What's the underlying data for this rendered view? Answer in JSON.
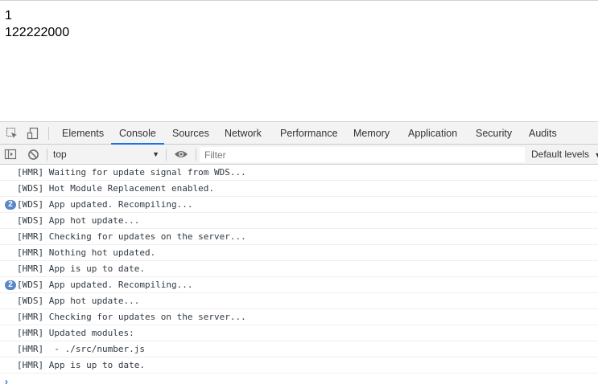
{
  "page": {
    "lines": [
      "1",
      "122222000"
    ]
  },
  "devtools": {
    "tabs": [
      {
        "label": "Elements",
        "active": false
      },
      {
        "label": "Console",
        "active": true
      },
      {
        "label": "Sources",
        "active": false
      },
      {
        "label": "Network",
        "active": false
      },
      {
        "label": "Performance",
        "active": false
      },
      {
        "label": "Memory",
        "active": false
      },
      {
        "label": "Application",
        "active": false
      },
      {
        "label": "Security",
        "active": false
      },
      {
        "label": "Audits",
        "active": false
      }
    ],
    "toolbar": {
      "context": "top",
      "filter_placeholder": "Filter",
      "levels_label": "Default levels"
    },
    "accent_color": "#1a73e8",
    "badge_color": "#5b86c9"
  },
  "console": {
    "rows": [
      {
        "text": "[HMR] Waiting for update signal from WDS...",
        "count": null
      },
      {
        "text": "[WDS] Hot Module Replacement enabled.",
        "count": null
      },
      {
        "text": "[WDS] App updated. Recompiling...",
        "count": "2"
      },
      {
        "text": "[WDS] App hot update...",
        "count": null
      },
      {
        "text": "[HMR] Checking for updates on the server...",
        "count": null
      },
      {
        "text": "[HMR] Nothing hot updated.",
        "count": null
      },
      {
        "text": "[HMR] App is up to date.",
        "count": null
      },
      {
        "text": "[WDS] App updated. Recompiling...",
        "count": "2"
      },
      {
        "text": "[WDS] App hot update...",
        "count": null
      },
      {
        "text": "[HMR] Checking for updates on the server...",
        "count": null
      },
      {
        "text": "[HMR] Updated modules:",
        "count": null
      },
      {
        "text": "[HMR]  - ./src/number.js",
        "count": null
      },
      {
        "text": "[HMR] App is up to date.",
        "count": null
      }
    ],
    "prompt_icon": "chevron-right-icon"
  }
}
